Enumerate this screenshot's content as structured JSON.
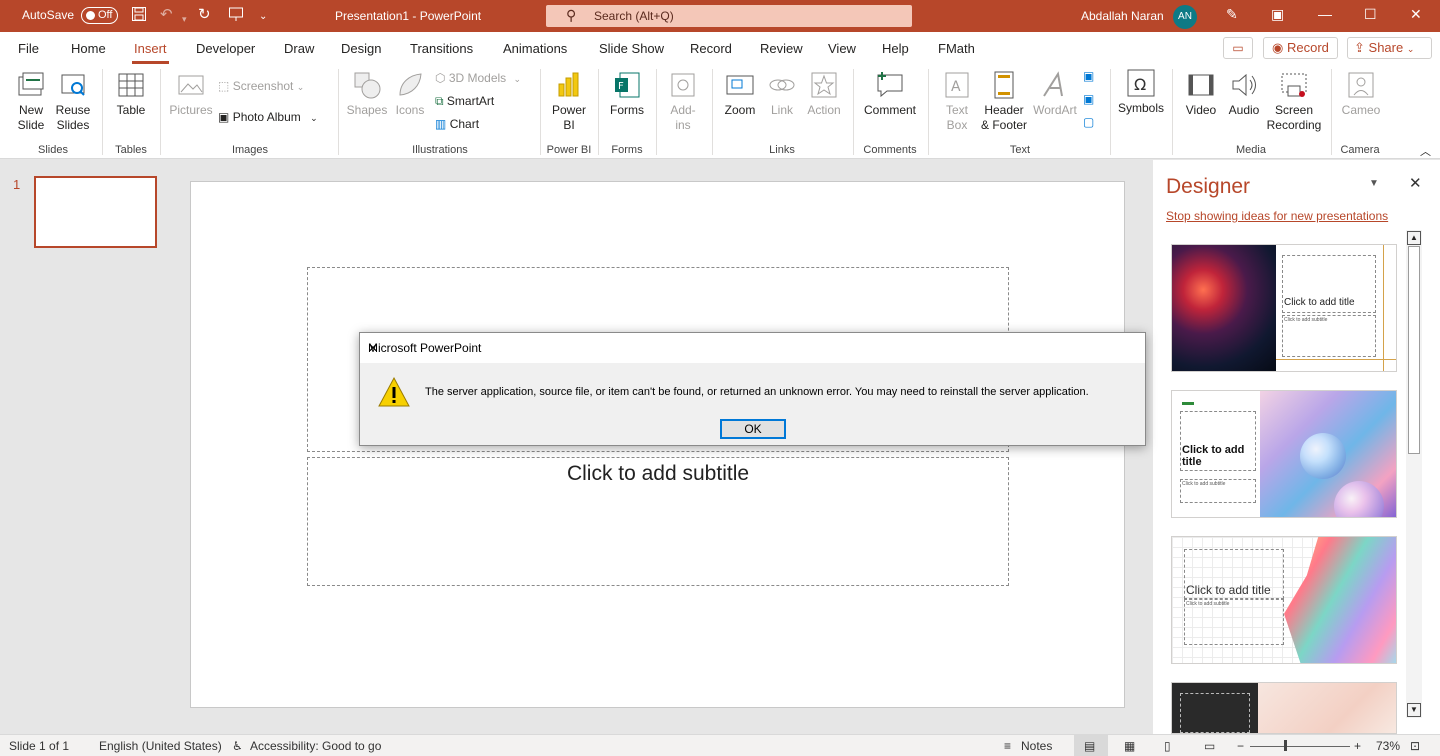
{
  "titlebar": {
    "autosave": "AutoSave",
    "toggle": "Off",
    "doc_title": "Presentation1  -  PowerPoint",
    "search_placeholder": "Search (Alt+Q)",
    "user_name": "Abdallah Naran",
    "initials": "AN"
  },
  "tabs": [
    "File",
    "Home",
    "Insert",
    "Developer",
    "Draw",
    "Design",
    "Transitions",
    "Animations",
    "Slide Show",
    "Record",
    "Review",
    "View",
    "Help",
    "FMath"
  ],
  "active_tab": "Insert",
  "actions": {
    "record": "Record",
    "share": "Share"
  },
  "ribbon": {
    "new_slide": "New\nSlide",
    "reuse_slides": "Reuse\nSlides",
    "table": "Table",
    "pictures": "Pictures",
    "screenshot": "Screenshot",
    "photo_album": "Photo Album",
    "shapes": "Shapes",
    "icons": "Icons",
    "models_3d": "3D Models",
    "smartart": "SmartArt",
    "chart": "Chart",
    "power_bi": "Power\nBI",
    "forms": "Forms",
    "addins": "Add-\nins",
    "zoom": "Zoom",
    "link": "Link",
    "action": "Action",
    "comment": "Comment",
    "text_box": "Text\nBox",
    "header_footer": "Header\n& Footer",
    "wordart": "WordArt",
    "symbols": "Symbols",
    "video": "Video",
    "audio": "Audio",
    "screen_recording": "Screen\nRecording",
    "cameo": "Cameo",
    "groups": {
      "slides": "Slides",
      "tables": "Tables",
      "images": "Images",
      "illustrations": "Illustrations",
      "power_bi": "Power BI",
      "forms": "Forms",
      "links": "Links",
      "comments": "Comments",
      "text": "Text",
      "media": "Media",
      "camera": "Camera"
    }
  },
  "thumbnails": {
    "slide_number": "1"
  },
  "slide": {
    "subtitle_placeholder": "Click to add subtitle"
  },
  "designer": {
    "title": "Designer",
    "link": "Stop showing ideas for new presentations",
    "card1_title": "Click to add title",
    "card1_sub": "Click to add subtitle",
    "card2_title": "Click to add title",
    "card2_sub": "Click to add subtitle",
    "card3_title": "Click to add title",
    "card3_sub": "Click to add subtitle"
  },
  "dialog": {
    "title": "Microsoft PowerPoint",
    "message": "The server application, source file, or item can't be found, or returned an unknown error. You may need to reinstall the server application.",
    "ok": "OK"
  },
  "status": {
    "slide": "Slide 1 of 1",
    "language": "English (United States)",
    "accessibility": "Accessibility: Good to go",
    "notes": "Notes",
    "zoom": "73%"
  },
  "colors": {
    "accent": "#b7472a",
    "avatar": "#0e7a85",
    "dialog_focus": "#0078d7",
    "warning": "#f7d000"
  }
}
